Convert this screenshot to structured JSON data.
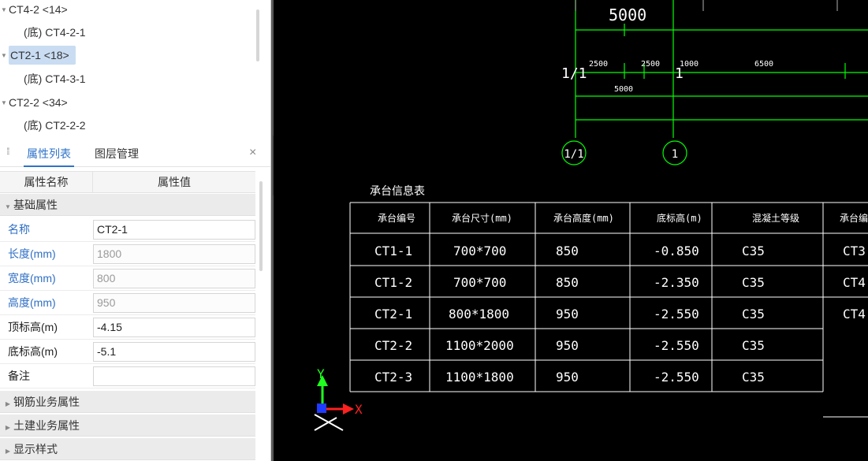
{
  "tree": {
    "items": [
      {
        "label": "CT4-2 <14>",
        "expanded": true,
        "selected": false,
        "child": false
      },
      {
        "label": "(底) CT4-2-1",
        "expanded": false,
        "selected": false,
        "child": true
      },
      {
        "label": "CT2-1 <18>",
        "expanded": true,
        "selected": true,
        "child": false
      },
      {
        "label": "(底) CT4-3-1",
        "expanded": false,
        "selected": false,
        "child": true
      },
      {
        "label": "CT2-2 <34>",
        "expanded": true,
        "selected": false,
        "child": false
      },
      {
        "label": "(底) CT2-2-2",
        "expanded": false,
        "selected": false,
        "child": true
      }
    ]
  },
  "panel": {
    "tabs": [
      {
        "label": "属性列表",
        "active": true
      },
      {
        "label": "图层管理",
        "active": false
      }
    ],
    "close_glyph": "×"
  },
  "props": {
    "header": {
      "name": "属性名称",
      "value": "属性值"
    },
    "basic_section": "基础属性",
    "rows": [
      {
        "name": "名称",
        "value": "CT2-1"
      },
      {
        "name": "长度(mm)",
        "value": "1800"
      },
      {
        "name": "宽度(mm)",
        "value": "800"
      },
      {
        "name": "高度(mm)",
        "value": "950"
      },
      {
        "name": "顶标高(m)",
        "value": "-4.15"
      },
      {
        "name": "底标高(m)",
        "value": "-5.1"
      },
      {
        "name": "备注",
        "value": ""
      }
    ],
    "collapsed_sections": [
      "钢筋业务属性",
      "土建业务属性",
      "显示样式"
    ]
  },
  "cad": {
    "dim_top": "5000",
    "dims_row": [
      "2500",
      "2500",
      "1000",
      "6500"
    ],
    "dim_sub": "5000",
    "axis_labels": [
      "1/1",
      "1"
    ],
    "axis_bubbles": [
      "1/1",
      "1"
    ],
    "table_title": "承台信息表",
    "table_headers": [
      "承台编号",
      "承台尺寸(mm)",
      "承台高度(mm)",
      "底标高(m)",
      "混凝土等级",
      "承台编"
    ],
    "table_rows": [
      [
        "CT1-1",
        "700*700",
        "850",
        "-0.850",
        "C35",
        "CT3"
      ],
      [
        "CT1-2",
        "700*700",
        "850",
        "-2.350",
        "C35",
        "CT4"
      ],
      [
        "CT2-1",
        "800*1800",
        "950",
        "-2.550",
        "C35",
        "CT4"
      ],
      [
        "CT2-2",
        "1100*2000",
        "950",
        "-2.550",
        "C35",
        ""
      ],
      [
        "CT2-3",
        "1100*1800",
        "950",
        "-2.550",
        "C35",
        ""
      ]
    ],
    "ucs_x": "X",
    "ucs_y": "Y",
    "colors": {
      "dim": "#00ff00",
      "axis": "#00ff00",
      "table_line": "#ffffff",
      "text": "#ffffff",
      "ucs_x": "#ff2020",
      "ucs_y": "#20ff20",
      "ucs_origin": "#1f3bff"
    }
  },
  "icons": {
    "tree_expand": "triangle-down-icon",
    "section_collapsed": "triangle-right-icon",
    "section_expanded": "triangle-down-icon",
    "grip": "grip-dots-icon",
    "close": "close-icon",
    "splitter": "chevron-left-icon"
  }
}
